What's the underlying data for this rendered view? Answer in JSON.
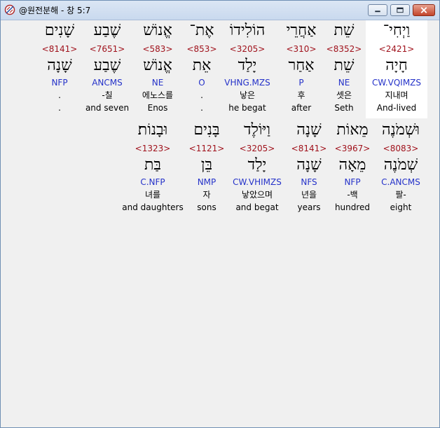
{
  "window": {
    "title": "@원전분해 - 창 5:7"
  },
  "verse": {
    "line1": [
      {
        "hebrew": "וַיְחִי־",
        "strong": "<2421>",
        "lemma": "חָיָה",
        "morph": "CW.VQIMZS",
        "korean": "지내며",
        "english": "And-lived"
      },
      {
        "hebrew": "שֵׁת",
        "strong": "<8352>",
        "lemma": "שֵׁת",
        "morph": "NE",
        "korean": "셋은",
        "english": "Seth"
      },
      {
        "hebrew": "אַחֲרֵי",
        "strong": "<310>",
        "lemma": "אַחַר",
        "morph": "P",
        "korean": "후",
        "english": "after"
      },
      {
        "hebrew": "הוֹלִידוֹ",
        "strong": "<3205>",
        "lemma": "יָלַד",
        "morph": "VHNG.MZS",
        "korean": "낳은",
        "english": "he begat"
      },
      {
        "hebrew": "אֶת־",
        "strong": "<853>",
        "lemma": "אֵת",
        "morph": "O",
        "korean": ".",
        "english": "."
      },
      {
        "hebrew": "אֱנוֹשׁ",
        "strong": "<583>",
        "lemma": "אֱנוֹשׁ",
        "morph": "NE",
        "korean": "에노스를",
        "english": "Enos"
      },
      {
        "hebrew": "שֶׁבַע",
        "strong": "<7651>",
        "lemma": "שֶׁבַע",
        "morph": "ANCMS",
        "korean": "-칠",
        "english": "and seven"
      },
      {
        "hebrew": "שָׁנִים",
        "strong": "<8141>",
        "lemma": "שָׁנָה",
        "morph": "NFP",
        "korean": ".",
        "english": "."
      }
    ],
    "line2": [
      {
        "hebrew": "וּשְׁמֹנֶה",
        "strong": "<8083>",
        "lemma": "שְׁמֹנֶה",
        "morph": "C.ANCMS",
        "korean": "팔-",
        "english": "eight"
      },
      {
        "hebrew": "מֵאוֹת",
        "strong": "<3967>",
        "lemma": "מֵאָה",
        "morph": "NFP",
        "korean": "-백",
        "english": "hundred"
      },
      {
        "hebrew": "שָׁנָה",
        "strong": "<8141>",
        "lemma": "שָׁנָה",
        "morph": "NFS",
        "korean": "년을",
        "english": "years"
      },
      {
        "hebrew": "וַיּוֹלֶד",
        "strong": "<3205>",
        "lemma": "יָלַד",
        "morph": "CW.VHIMZS",
        "korean": "낳았으며",
        "english": "and begat"
      },
      {
        "hebrew": "בָּנִים",
        "strong": "<1121>",
        "lemma": "בֵּן",
        "morph": "NMP",
        "korean": "자",
        "english": "sons"
      },
      {
        "hebrew": "וּבָנוֹת׃",
        "strong": "<1323>",
        "lemma": "בַּת",
        "morph": "C.NFP",
        "korean": "녀를",
        "english": "and daughters"
      }
    ]
  }
}
